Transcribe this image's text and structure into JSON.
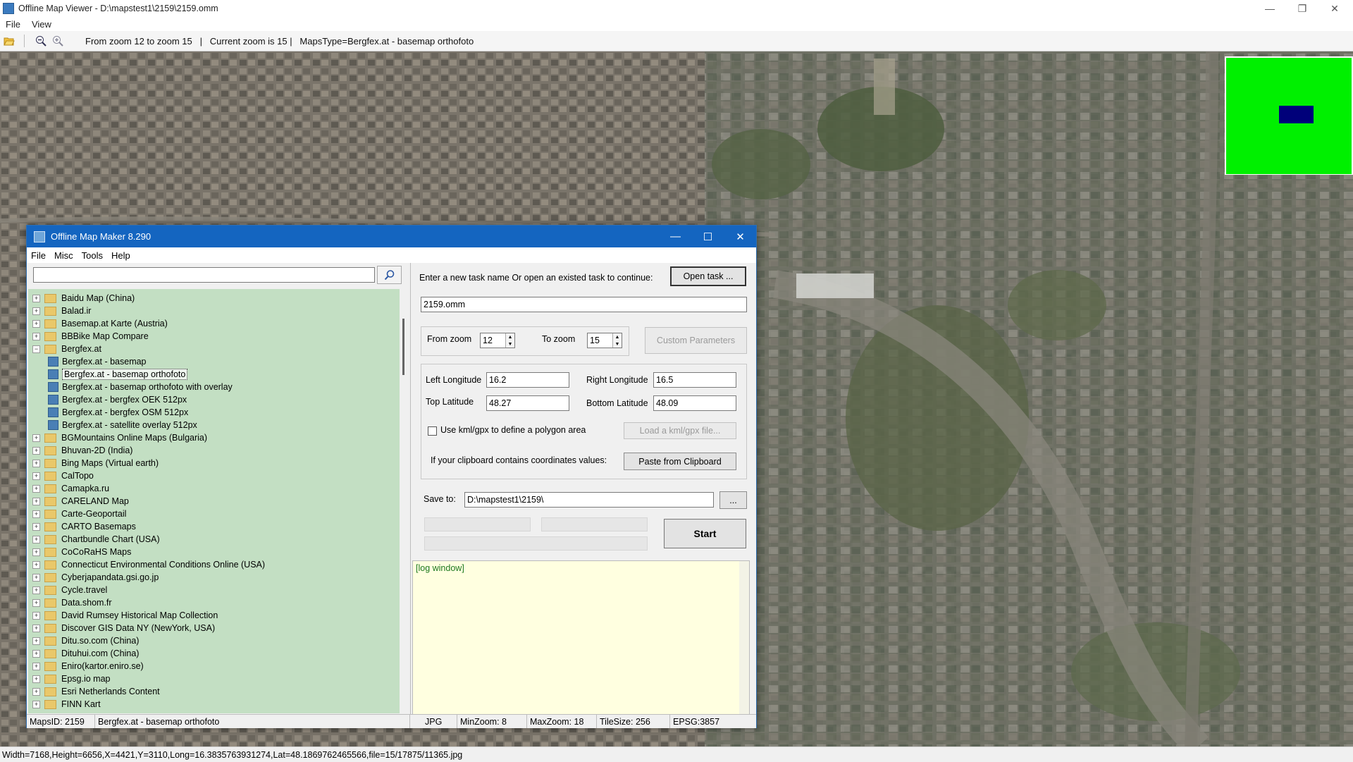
{
  "viewer": {
    "title": "Offline Map Viewer - D:\\mapstest1\\2159\\2159.omm",
    "menu": [
      "File",
      "View"
    ],
    "toolbar_info": "From zoom 12 to zoom 15   |   Current zoom is 15 |   MapsType=Bergfex.at - basemap orthofoto",
    "status": "Width=7168,Height=6656,X=4421,Y=3110,Long=16.3835763931274,Lat=48.1869762465566,file=15/17875/11365.jpg",
    "icons": [
      "open-folder-icon",
      "zoom-out-icon",
      "zoom-in-icon"
    ]
  },
  "dialog": {
    "title": "Offline Map Maker 8.290",
    "menu": [
      "File",
      "Misc",
      "Tools",
      "Help"
    ],
    "search_value": "",
    "tree": [
      {
        "label": "Baidu Map (China)",
        "level": 0,
        "expanded": false
      },
      {
        "label": "Balad.ir",
        "level": 0,
        "expanded": false
      },
      {
        "label": "Basemap.at Karte (Austria)",
        "level": 0,
        "expanded": false
      },
      {
        "label": "BBBike Map Compare",
        "level": 0,
        "expanded": false
      },
      {
        "label": "Bergfex.at",
        "level": 0,
        "expanded": true
      },
      {
        "label": "Bergfex.at - basemap",
        "level": 1
      },
      {
        "label": "Bergfex.at - basemap orthofoto",
        "level": 1,
        "selected": true
      },
      {
        "label": "Bergfex.at - basemap orthofoto with overlay",
        "level": 1
      },
      {
        "label": "Bergfex.at - bergfex OEK 512px",
        "level": 1
      },
      {
        "label": "Bergfex.at - bergfex OSM 512px",
        "level": 1
      },
      {
        "label": "Bergfex.at - satellite overlay 512px",
        "level": 1
      },
      {
        "label": "BGMountains Online Maps (Bulgaria)",
        "level": 0,
        "expanded": false
      },
      {
        "label": "Bhuvan-2D (India)",
        "level": 0,
        "expanded": false
      },
      {
        "label": "Bing Maps (Virtual earth)",
        "level": 0,
        "expanded": false
      },
      {
        "label": "CalTopo",
        "level": 0,
        "expanded": false
      },
      {
        "label": "Camapka.ru",
        "level": 0,
        "expanded": false
      },
      {
        "label": "CARELAND Map",
        "level": 0,
        "expanded": false
      },
      {
        "label": "Carte-Geoportail",
        "level": 0,
        "expanded": false
      },
      {
        "label": "CARTO Basemaps",
        "level": 0,
        "expanded": false
      },
      {
        "label": "Chartbundle Chart (USA)",
        "level": 0,
        "expanded": false
      },
      {
        "label": "CoCoRaHS Maps",
        "level": 0,
        "expanded": false
      },
      {
        "label": "Connecticut Environmental Conditions Online (USA)",
        "level": 0,
        "expanded": false
      },
      {
        "label": "Cyberjapandata.gsi.go.jp",
        "level": 0,
        "expanded": false
      },
      {
        "label": "Cycle.travel",
        "level": 0,
        "expanded": false
      },
      {
        "label": "Data.shom.fr",
        "level": 0,
        "expanded": false
      },
      {
        "label": "David Rumsey Historical Map Collection",
        "level": 0,
        "expanded": false
      },
      {
        "label": "Discover GIS Data NY (NewYork, USA)",
        "level": 0,
        "expanded": false
      },
      {
        "label": "Ditu.so.com (China)",
        "level": 0,
        "expanded": false
      },
      {
        "label": "Dituhui.com (China)",
        "level": 0,
        "expanded": false
      },
      {
        "label": "Eniro(kartor.eniro.se)",
        "level": 0,
        "expanded": false
      },
      {
        "label": "Epsg.io map",
        "level": 0,
        "expanded": false
      },
      {
        "label": "Esri Netherlands Content",
        "level": 0,
        "expanded": false
      },
      {
        "label": "FINN Kart",
        "level": 0,
        "expanded": false
      }
    ],
    "task_prompt": "Enter a new task name Or open an existed task to continue:",
    "open_task_label": "Open task ...",
    "task_name": "2159.omm",
    "from_zoom_label": "From zoom",
    "from_zoom": "12",
    "to_zoom_label": "To zoom",
    "to_zoom": "15",
    "custom_params_label": "Custom Parameters",
    "left_lon_label": "Left Longitude",
    "left_lon": "16.2",
    "right_lon_label": "Right Longitude",
    "right_lon": "16.5",
    "top_lat_label": "Top Latitude",
    "top_lat": "48.27",
    "bottom_lat_label": "Bottom Latitude",
    "bottom_lat": "48.09",
    "kml_check_label": "Use kml/gpx to define a polygon area",
    "kml_checked": false,
    "load_kml_label": "Load a kml/gpx file...",
    "clipboard_label": "If your clipboard contains coordinates values:",
    "paste_label": "Paste from Clipboard",
    "save_to_label": "Save to:",
    "save_to": "D:\\mapstest1\\2159\\",
    "browse_label": "...",
    "start_label": "Start",
    "log_text": "[log window]",
    "status": {
      "maps_id": "MapsID: 2159",
      "maps_name": "Bergfex.at - basemap orthofoto",
      "format": "JPG",
      "min_zoom": "MinZoom: 8",
      "max_zoom": "MaxZoom: 18",
      "tile_size": "TileSize: 256",
      "epsg": "EPSG:3857"
    }
  },
  "colors": {
    "dialog_title_bar": "#1465c0",
    "tree_background": "#c3dfc3",
    "log_background": "#ffffe0",
    "overview_green": "#00f000",
    "overview_blue": "#00007a"
  }
}
